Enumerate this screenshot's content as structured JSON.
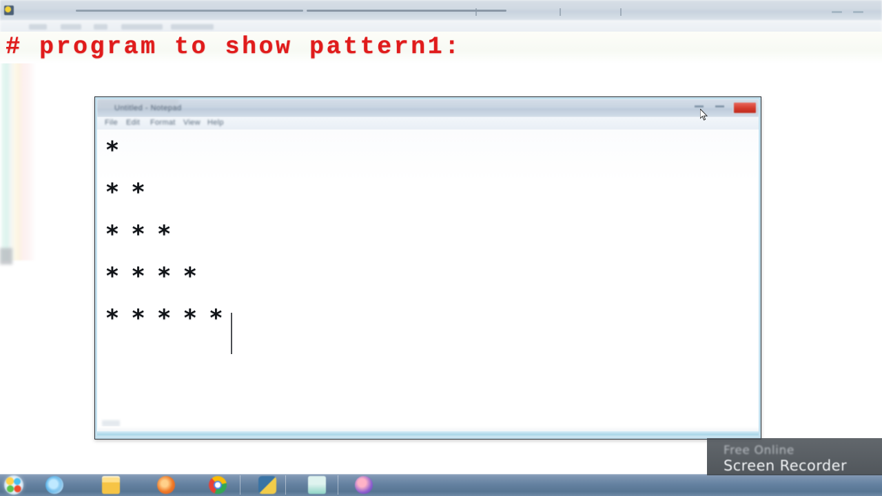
{
  "editor": {
    "comment_line": "# program to show pattern1:",
    "comment_color": "#e01b1b",
    "background_color": "#ffffff"
  },
  "notepad": {
    "title": "Untitled - Notepad",
    "menu": [
      "File",
      "Edit",
      "Format",
      "View",
      "Help"
    ],
    "window_controls": {
      "minimize": "Minimize",
      "maximize": "Maximize",
      "close": "Close",
      "close_color": "#d33a2c"
    },
    "output_lines": [
      "*",
      "* *",
      "* * *",
      "* * * *",
      "* * * * *"
    ],
    "output_text": "*\n* *\n* * *\n* * * *\n* * * * *",
    "caret_visible": "true"
  },
  "taskbar": {
    "start_label": "Start",
    "items": [
      {
        "name": "internet-explorer",
        "label": "Internet Explorer"
      },
      {
        "name": "file-explorer",
        "label": "File Explorer"
      },
      {
        "name": "firefox",
        "label": "Mozilla Firefox"
      },
      {
        "name": "chrome",
        "label": "Google Chrome"
      },
      {
        "name": "python",
        "label": "Python"
      },
      {
        "name": "explorer-window",
        "label": "Windows Explorer"
      },
      {
        "name": "media-app",
        "label": "Media App"
      }
    ]
  },
  "watermark": {
    "line1": "Free Online",
    "line2": "Screen Recorder"
  }
}
